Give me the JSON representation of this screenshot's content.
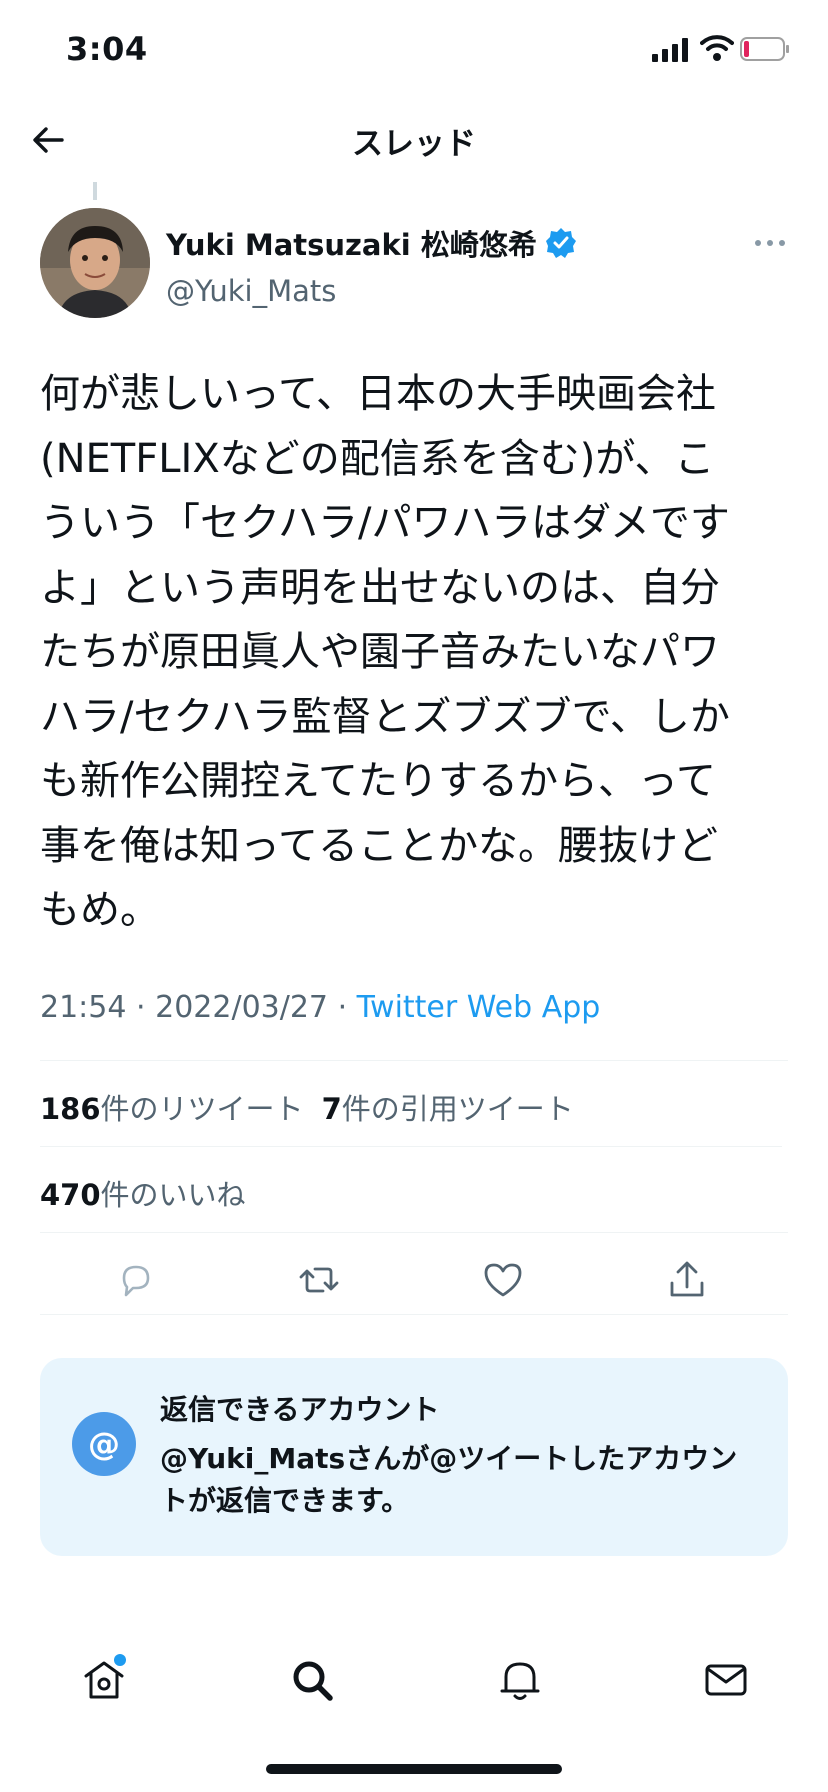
{
  "status_bar": {
    "time": "3:04"
  },
  "header": {
    "title": "スレッド"
  },
  "tweet": {
    "author_name": "Yuki Matsuzaki 松崎悠希",
    "handle": "@Yuki_Mats",
    "text": "何が悲しいって、日本の大手映画会社\n(NETFLIXなどの配信系を含む)が、こ\nういう「セクハラ/パワハラはダメです\nよ」という声明を出せないのは、自分\nたちが原田眞人や園子音みたいなパワ\nハラ/セクハラ監督とズブズブで、しか\nも新作公開控えてたりするから、って\n事を俺は知ってることかな。腰抜けど\nもめ。",
    "time": "21:54",
    "separator": "·",
    "date": "2022/03/27",
    "source": "Twitter Web App",
    "retweets_count": "186",
    "retweets_label": "件のリツイート",
    "quotes_count": "7",
    "quotes_label": "件の引用ツイート",
    "likes_count": "470",
    "likes_label": "件のいいね"
  },
  "reply_notice": {
    "icon_label": "@",
    "title": "返信できるアカウント",
    "body": "@Yuki_Matsさんが@ツイートしたアカウントが返信できます。"
  },
  "icons": {
    "back": "arrow-left-icon",
    "more": "more-dots-icon",
    "reply": "reply-icon",
    "retweet": "retweet-icon",
    "like": "heart-icon",
    "share": "share-icon",
    "home": "home-icon",
    "search": "search-icon",
    "notifications": "bell-icon",
    "messages": "mail-icon"
  },
  "colors": {
    "accent": "#1d9bf0",
    "secondary_text": "#536471",
    "notice_bg": "#e8f5fd"
  }
}
